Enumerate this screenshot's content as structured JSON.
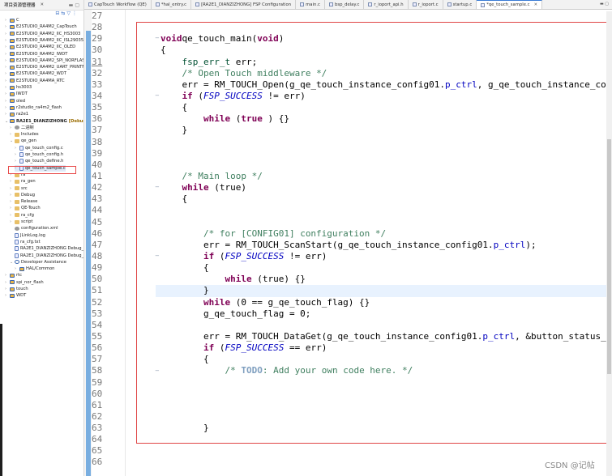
{
  "sidebar": {
    "title": "项目资源管理器",
    "items": [
      {
        "label": "C",
        "type": "proj",
        "depth": 0,
        "chev": ">"
      },
      {
        "label": "E2STUDIO_RA4M2_CapTouch",
        "type": "proj",
        "depth": 0,
        "chev": ">"
      },
      {
        "label": "E2STUDIO_RA4M2_IIC_HS3003",
        "type": "proj",
        "depth": 0,
        "chev": ">"
      },
      {
        "label": "E2STUDIO_RA4M2_IIC_ISL29035",
        "type": "proj",
        "depth": 0,
        "chev": ">"
      },
      {
        "label": "E2STUDIO_RA4M2_IIC_OLED",
        "type": "proj",
        "depth": 0,
        "chev": ">"
      },
      {
        "label": "E2STUDIO_RA4M2_IWDT",
        "type": "proj",
        "depth": 0,
        "chev": ">"
      },
      {
        "label": "E2STUDIO_RA4M2_SPI_NORFLASH",
        "type": "proj",
        "depth": 0,
        "chev": ">"
      },
      {
        "label": "E2STUDIO_RA4M2_UART_PRINTF",
        "type": "proj",
        "depth": 0,
        "chev": ">"
      },
      {
        "label": "E2STUDIO_RA4M2_WDT",
        "type": "proj",
        "depth": 0,
        "chev": ">"
      },
      {
        "label": "E2STUDIO_RA4MA_RTC",
        "type": "proj",
        "depth": 0,
        "chev": ">"
      },
      {
        "label": "hs3003",
        "type": "proj",
        "depth": 0,
        "chev": ">"
      },
      {
        "label": "IWDT",
        "type": "proj",
        "depth": 0,
        "chev": ">"
      },
      {
        "label": "oled",
        "type": "proj",
        "depth": 0,
        "chev": ">"
      },
      {
        "label": "r2studio_ra4m2_flash",
        "type": "proj",
        "depth": 0,
        "chev": ">"
      },
      {
        "label": "ra2e1",
        "type": "proj",
        "depth": 0,
        "chev": ">"
      },
      {
        "label": "RA2E1_DIANZIZHONG",
        "suffix": "[Debug]",
        "type": "proj",
        "depth": 0,
        "chev": "v",
        "bold": true
      },
      {
        "label": "二进制",
        "type": "gear",
        "depth": 1,
        "chev": ">"
      },
      {
        "label": "Includes",
        "type": "folder",
        "depth": 1,
        "chev": ">"
      },
      {
        "label": "qe_gen",
        "type": "folder",
        "depth": 1,
        "chev": "v"
      },
      {
        "label": "qe_touch_config.c",
        "type": "file",
        "depth": 2,
        "chev": ">"
      },
      {
        "label": "qe_touch_config.h",
        "type": "file",
        "depth": 2,
        "chev": ">"
      },
      {
        "label": "qe_touch_define.h",
        "type": "file",
        "depth": 2,
        "chev": ">"
      },
      {
        "label": "qe_touch_sample.c",
        "type": "file",
        "depth": 2,
        "chev": ">",
        "selected": true
      },
      {
        "label": "ra",
        "type": "folder",
        "depth": 1,
        "chev": ">"
      },
      {
        "label": "ra_gen",
        "type": "folder",
        "depth": 1,
        "chev": ">"
      },
      {
        "label": "src",
        "type": "folder",
        "depth": 1,
        "chev": ">"
      },
      {
        "label": "Debug",
        "type": "folder",
        "depth": 1,
        "chev": ">"
      },
      {
        "label": "Release",
        "type": "folder",
        "depth": 1,
        "chev": ">"
      },
      {
        "label": "QE-Touch",
        "type": "folder",
        "depth": 1,
        "chev": ">"
      },
      {
        "label": "ra_cfg",
        "type": "folder",
        "depth": 1,
        "chev": ">"
      },
      {
        "label": "script",
        "type": "folder",
        "depth": 1,
        "chev": ">"
      },
      {
        "label": "configuration.xml",
        "type": "gear",
        "depth": 1,
        "chev": ""
      },
      {
        "label": "JLinkLog.log",
        "type": "file",
        "depth": 1,
        "chev": ""
      },
      {
        "label": "ra_cfg.txt",
        "type": "file",
        "depth": 1,
        "chev": ""
      },
      {
        "label": "RA2E1_DIANZIZHONG Debug_",
        "type": "file",
        "depth": 1,
        "chev": ""
      },
      {
        "label": "RA2E1_DIANZIZHONG Debug_",
        "type": "file",
        "depth": 1,
        "chev": ""
      },
      {
        "label": "Developer Assistance",
        "type": "help",
        "depth": 1,
        "chev": "v"
      },
      {
        "label": "HAL/Common",
        "type": "proj",
        "depth": 2,
        "chev": ">"
      },
      {
        "label": "rtc",
        "type": "proj",
        "depth": 0,
        "chev": ">"
      },
      {
        "label": "spi_nor_flash",
        "type": "proj",
        "depth": 0,
        "chev": ">"
      },
      {
        "label": "touch",
        "type": "proj",
        "depth": 0,
        "chev": ">"
      },
      {
        "label": "WDT",
        "type": "proj",
        "depth": 0,
        "chev": ">"
      }
    ]
  },
  "tabs": [
    {
      "label": "CapTouch Workflow (QE)"
    },
    {
      "label": "*hal_entry.c"
    },
    {
      "label": "[RA2E1_DIANZIZHONG] FSP Configuration"
    },
    {
      "label": "main.c"
    },
    {
      "label": "bsp_delay.c"
    },
    {
      "label": "r_ioport_api.h"
    },
    {
      "label": "r_ioport.c"
    },
    {
      "label": "startup.c"
    },
    {
      "label": "*qe_touch_sample.c",
      "active": true
    }
  ],
  "editor": {
    "first_line": 27,
    "current_line": 51,
    "fold_lines": [
      29,
      34,
      42,
      48,
      58
    ],
    "lines": [
      [],
      [],
      [
        [
          "kw",
          "void"
        ],
        [
          "",
          "qe_touch_main("
        ],
        [
          "kw",
          "void"
        ],
        [
          "",
          ")"
        ]
      ],
      [
        [
          "",
          "{"
        ]
      ],
      [
        [
          "",
          "    "
        ],
        [
          "ty",
          "fsp_err_t"
        ],
        [
          "",
          " err;"
        ]
      ],
      [
        [
          "",
          "    "
        ],
        [
          "cm",
          "/* Open Touch middleware */"
        ]
      ],
      [
        [
          "",
          "    err = RM_TOUCH_Open(g_qe_touch_instance_config01."
        ],
        [
          "fld",
          "p_ctrl"
        ],
        [
          "",
          ", g_qe_touch_instance_co"
        ]
      ],
      [
        [
          "",
          "    "
        ],
        [
          "kw",
          "if"
        ],
        [
          "",
          " ("
        ],
        [
          "mac",
          "FSP_SUCCESS"
        ],
        [
          "",
          " != err)"
        ]
      ],
      [
        [
          "",
          "    {"
        ]
      ],
      [
        [
          "",
          "        "
        ],
        [
          "kw",
          "while"
        ],
        [
          "",
          " ("
        ],
        [
          "kw",
          "true"
        ],
        [
          "",
          " ) {}"
        ]
      ],
      [
        [
          "",
          "    }"
        ]
      ],
      [],
      [],
      [],
      [
        [
          "",
          "    "
        ],
        [
          "cm",
          "/* Main loop */"
        ]
      ],
      [
        [
          "",
          "    "
        ],
        [
          "kw",
          "while"
        ],
        [
          "",
          " (true)"
        ]
      ],
      [
        [
          "",
          "    {"
        ]
      ],
      [],
      [],
      [
        [
          "",
          "        "
        ],
        [
          "cm",
          "/* for [CONFIG01] configuration */"
        ]
      ],
      [
        [
          "",
          "        err = RM_TOUCH_ScanStart(g_qe_touch_instance_config01."
        ],
        [
          "fld",
          "p_ctrl"
        ],
        [
          "",
          ");"
        ]
      ],
      [
        [
          "",
          "        "
        ],
        [
          "kw",
          "if"
        ],
        [
          "",
          " ("
        ],
        [
          "mac",
          "FSP_SUCCESS"
        ],
        [
          "",
          " != err)"
        ]
      ],
      [
        [
          "",
          "        {"
        ]
      ],
      [
        [
          "",
          "            "
        ],
        [
          "kw",
          "while"
        ],
        [
          "",
          " (true) {}"
        ]
      ],
      [
        [
          "",
          "        }"
        ]
      ],
      [
        [
          "",
          "        "
        ],
        [
          "kw",
          "while"
        ],
        [
          "",
          " (0 == g_qe_touch_flag) {}"
        ]
      ],
      [
        [
          "",
          "        g_qe_touch_flag = 0;"
        ]
      ],
      [],
      [
        [
          "",
          "        err = RM_TOUCH_DataGet(g_qe_touch_instance_config01."
        ],
        [
          "fld",
          "p_ctrl"
        ],
        [
          "",
          ", &button_status_"
        ]
      ],
      [
        [
          "",
          "        "
        ],
        [
          "kw",
          "if"
        ],
        [
          "",
          " ("
        ],
        [
          "mac",
          "FSP_SUCCESS"
        ],
        [
          "",
          " == err)"
        ]
      ],
      [
        [
          "",
          "        {"
        ]
      ],
      [
        [
          "",
          "            "
        ],
        [
          "cm",
          "/* "
        ],
        [
          "todo",
          "TODO"
        ],
        [
          "cm",
          ": Add your own code here. */"
        ]
      ],
      [],
      [],
      [],
      [],
      [
        [
          "",
          "        }"
        ]
      ],
      [],
      [],
      []
    ]
  },
  "watermark": "CSDN @记帖"
}
